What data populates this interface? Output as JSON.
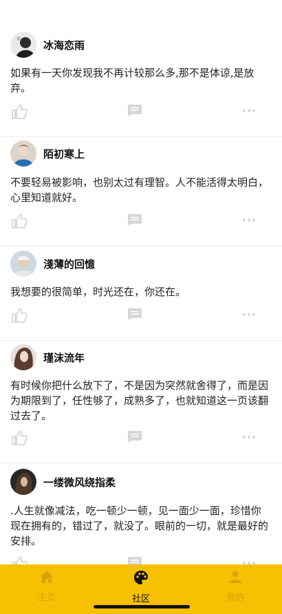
{
  "posts": [
    {
      "username": "冰海恋雨",
      "text": "如果有一天你发现我不再计较那么多,那不是体谅,是放弃。"
    },
    {
      "username": "陌初寒上",
      "text": "不要轻易被影响，也别太过有理智。人不能活得太明白，心里知道就好。"
    },
    {
      "username": "淺薄的回憶",
      "text": "我想要的很简单，时光还在，你还在。"
    },
    {
      "username": "瑾沫流年",
      "text": "有时候你把什么放下了，不是因为突然就舍得了，而是因为期限到了，任性够了，成熟多了，也就知道这一页该翻过去了。"
    },
    {
      "username": "一缕微风绕指柔",
      "text": ".人生就像减法，吃一顿少一顿，见一面少一面，珍惜你现在拥有的，错过了，就没了。眼前的一切，就是最好的安排。"
    }
  ],
  "icons": {
    "like": "thumbs-up-icon",
    "comment": "comment-icon",
    "more": "more-dots-icon"
  },
  "tabbar": {
    "home_label": "主页",
    "community_label": "社区",
    "mine_label": "我的",
    "active_tab": "community"
  },
  "colors": {
    "tabbar_bg": "#f7c003",
    "tab_inactive": "#d8a405",
    "tab_active": "#111111",
    "action_icon": "#d6d6d6"
  }
}
